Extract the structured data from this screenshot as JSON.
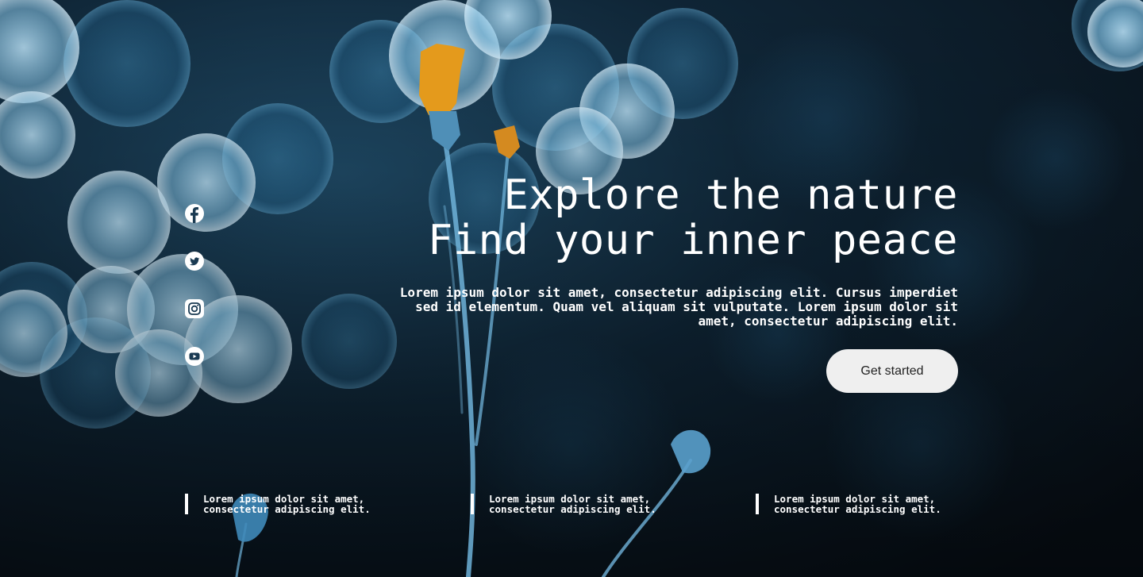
{
  "colors": {
    "background": "#0d1b26",
    "text": "#ffffff",
    "button_bg": "#efefef",
    "button_text": "#222222",
    "flower": "#e49a1c",
    "bokeh": "#7cc6ee"
  },
  "social": [
    {
      "name": "facebook",
      "icon": "facebook-icon"
    },
    {
      "name": "twitter",
      "icon": "twitter-icon"
    },
    {
      "name": "instagram",
      "icon": "instagram-icon"
    },
    {
      "name": "youtube",
      "icon": "youtube-icon"
    }
  ],
  "hero": {
    "title_line1": "Explore the nature",
    "title_line2": "Find your inner peace",
    "description": "Lorem ipsum dolor sit amet, consectetur adipiscing elit. Cursus imperdiet sed id elementum. Quam vel aliquam sit vulputate. Lorem ipsum dolor sit amet, consectetur adipiscing elit.",
    "cta_label": "Get started"
  },
  "features": [
    {
      "line1": "Lorem ipsum dolor sit amet,",
      "line2": "consectetur adipiscing elit."
    },
    {
      "line1": "Lorem ipsum dolor sit amet,",
      "line2": "consectetur adipiscing elit."
    },
    {
      "line1": "Lorem ipsum dolor sit amet,",
      "line2": "consectetur adipiscing elit."
    }
  ]
}
